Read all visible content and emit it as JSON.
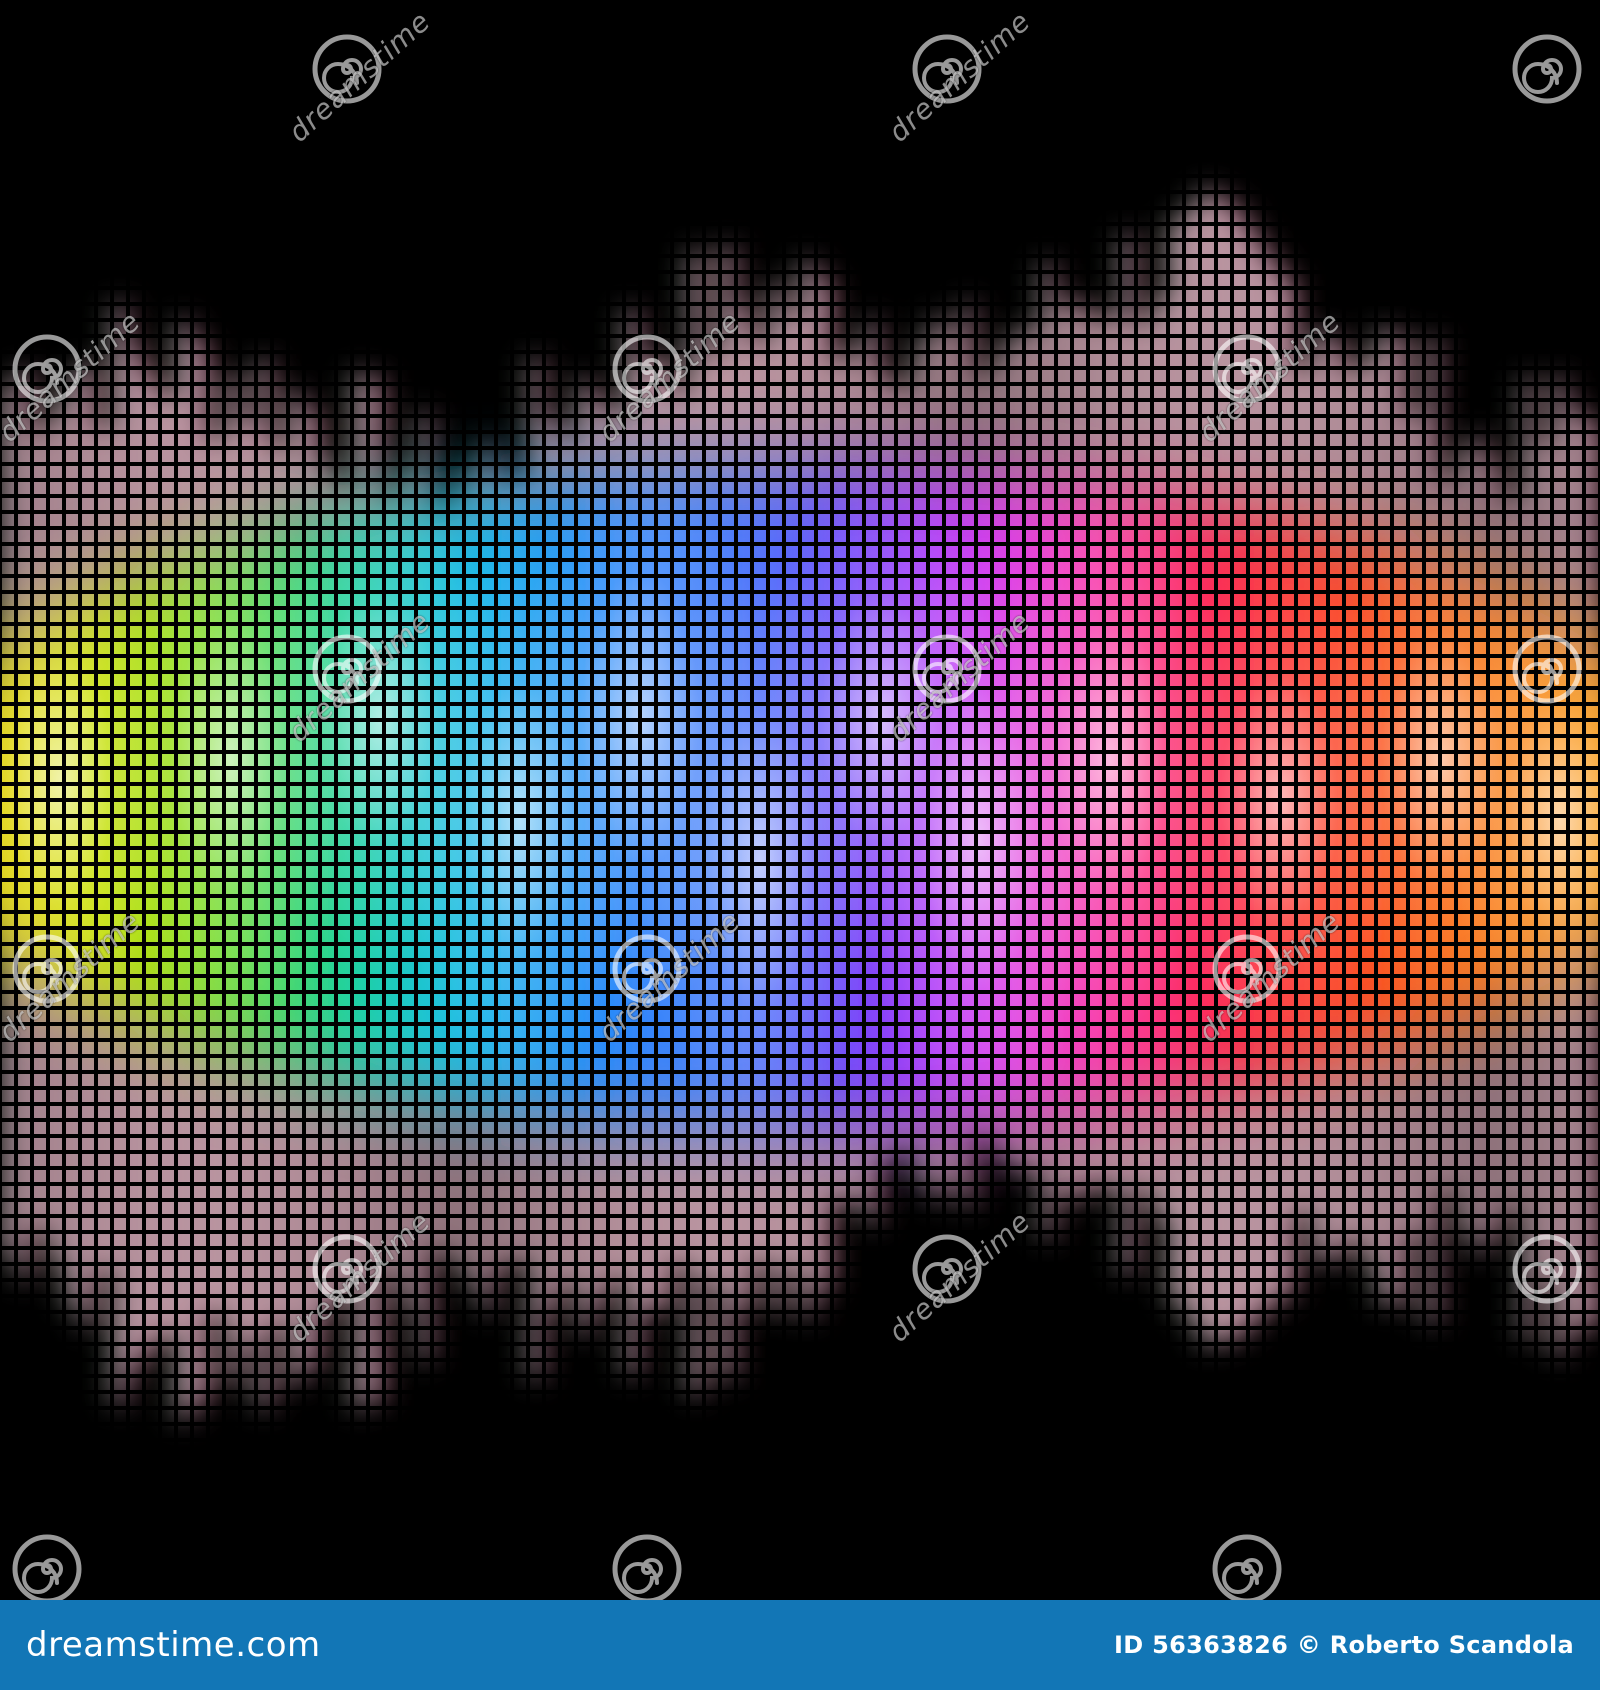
{
  "image": {
    "subject": "rainbow spectrum equalizer of glowing square tiles on black",
    "background_color": "#000000",
    "palette": [
      "#f5d000",
      "#9fe000",
      "#12d38a",
      "#19b7f2",
      "#2d6bff",
      "#7a2cff",
      "#ff3ad7",
      "#ff1e3c",
      "#ff7a10",
      "#ffb800"
    ]
  },
  "watermark": {
    "text": "dreamstime",
    "icon": "spiral-icon"
  },
  "footer": {
    "background_color": "#1276b6",
    "brand": "dreamstime.com",
    "credit": "ID 56363826 © Roberto Scandola"
  }
}
